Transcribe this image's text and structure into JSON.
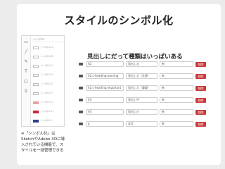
{
  "title": "スタイルのシンボル化",
  "subtitle": "見出しにだって種類はいっぱいある",
  "note": "※「シンボル化」はSketchやAdobe XDに導入されている機能で、スタイルを一括管理できる",
  "mock_panel": {
    "header": "シンボル",
    "items": [
      {
        "label": "シンボル A",
        "swatch": "#ffffff"
      },
      {
        "label": "シンボル B",
        "swatch": "#ffffff"
      },
      {
        "label": "シンボル C",
        "swatch": "#ffffff"
      },
      {
        "label": "シンボル D",
        "swatch": "#ffffff"
      },
      {
        "label": "シンボル E",
        "swatch": "#ffffff"
      },
      {
        "label": "シンボル F",
        "swatch": "#ffffff"
      },
      {
        "label": "シンボル G",
        "swatch": "#e8a0a8"
      },
      {
        "label": "シンボル H",
        "swatch": "#cc2233"
      },
      {
        "label": "シンボル I",
        "swatch": "#2b3f8a"
      }
    ]
  },
  "table_rows": [
    {
      "name": "h2",
      "style": "見出し大",
      "value": "有",
      "button": "削除"
    },
    {
      "name": "h2.c-heading.warning",
      "style": "見出し大（注意）",
      "value": "有",
      "button": "削除"
    },
    {
      "name": "h2.c-heading.important",
      "style": "見出し大（重要）",
      "value": "有",
      "button": "削除"
    },
    {
      "name": "h3",
      "style": "見出し中",
      "value": "有",
      "button": "削除"
    },
    {
      "name": "h4",
      "style": "見出し小",
      "value": "有",
      "button": "削除"
    },
    {
      "name": "p",
      "style": "本文",
      "value": "有",
      "button": "削除"
    }
  ],
  "colors": {
    "accent": "#c93a3a"
  }
}
